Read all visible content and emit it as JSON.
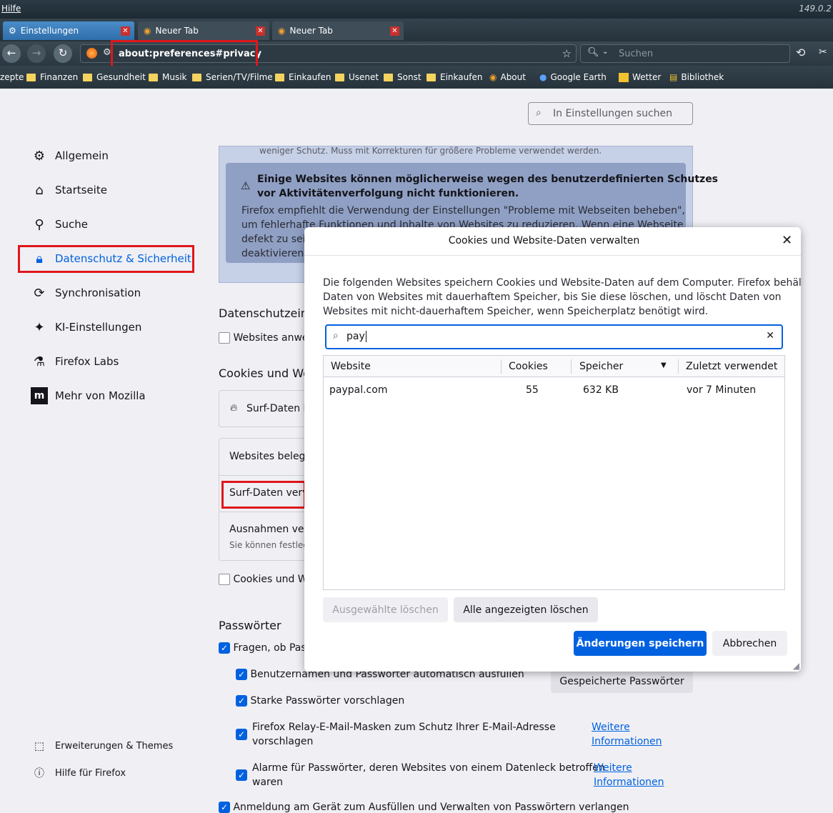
{
  "menubar": {
    "menu_help": "Hilfe",
    "version": "149.0.2"
  },
  "tabs": [
    {
      "label": "Einstellungen",
      "active": true
    },
    {
      "label": "Neuer Tab",
      "active": false
    },
    {
      "label": "Neuer Tab",
      "active": false
    }
  ],
  "urlbar": {
    "url": "about:preferences#privacy"
  },
  "searchbar": {
    "placeholder": "Suchen"
  },
  "bookmarks": [
    {
      "label": "zepte",
      "kind": "cut"
    },
    {
      "label": "Finanzen",
      "kind": "folder"
    },
    {
      "label": "Gesundheit",
      "kind": "folder"
    },
    {
      "label": "Musik",
      "kind": "folder"
    },
    {
      "label": "Serien/TV/Filme",
      "kind": "folder"
    },
    {
      "label": "Einkaufen",
      "kind": "folder"
    },
    {
      "label": "Usenet",
      "kind": "folder"
    },
    {
      "label": "Sonst",
      "kind": "folder"
    },
    {
      "label": "Einkaufen",
      "kind": "folder"
    },
    {
      "label": "About",
      "kind": "link"
    },
    {
      "label": "Google Earth",
      "kind": "link"
    },
    {
      "label": "Wetter",
      "kind": "link"
    },
    {
      "label": "Bibliothek",
      "kind": "link"
    }
  ],
  "prefs_search": {
    "placeholder": "In Einstellungen suchen"
  },
  "sidebar": {
    "items": [
      {
        "label": "Allgemein"
      },
      {
        "label": "Startseite"
      },
      {
        "label": "Suche"
      },
      {
        "label": "Datenschutz & Sicherheit"
      },
      {
        "label": "Synchronisation"
      },
      {
        "label": "KI-Einstellungen"
      },
      {
        "label": "Firefox Labs"
      },
      {
        "label": "Mehr von Mozilla"
      }
    ],
    "footer": [
      {
        "label": "Erweiterungen & Themes"
      },
      {
        "label": "Hilfe für Firefox"
      }
    ]
  },
  "main": {
    "top_note": "weniger Schutz. Muss mit Korrekturen für größere Probleme verwendet werden.",
    "warning_title_1": "Einige Websites können möglicherweise wegen des benutzerdefinierten Schutzes",
    "warning_title_2": "vor Aktivitätenverfolgung nicht funktionieren.",
    "warning_body_1": "Firefox empfiehlt die Verwendung der Einstellungen \"Probleme mit Webseiten beheben\",",
    "warning_body_2": "um fehlerhafte Funktionen und Inhalte von Websites zu reduzieren. Wenn eine Webseite",
    "warning_body_3": "defekt zu sein",
    "warning_body_4": "deaktivieren,",
    "heading_privacy_prefs": "Datenschutzein",
    "websites_checkbox": "Websites anwe",
    "heading_cookies": "Cookies und We",
    "surf_data_button": "Surf-Daten l",
    "websites_occupy": "Websites belege",
    "surf_data_manage": "Surf-Daten verv",
    "exceptions": "Ausnahmen verv",
    "exceptions_sub": "Sie können festleg",
    "cookies_checkbox": "Cookies und W",
    "heading_passwords": "Passwörter",
    "ask_save": "Fragen, ob Pas",
    "autofill": "Benutzernamen und Passwörter automatisch ausfüllen",
    "saved_passwords_button": "Gespeicherte Passwörter",
    "strong_pw": "Starke Passwörter vorschlagen",
    "relay_1": "Firefox Relay-E-Mail-Masken zum Schutz Ihrer E-Mail-Adresse",
    "relay_2": "vorschlagen",
    "more_info_1a": "Weitere",
    "more_info_1b": "Informationen",
    "breach_1": "Alarme für Passwörter, deren Websites von einem Datenleck betroffen",
    "breach_2": "waren",
    "more_info_2a": "Weitere",
    "more_info_2b": "Informationen",
    "bottom_cut": "Anmeldung am Gerät zum Ausfüllen und Verwalten von Passwörtern verlangen"
  },
  "dialog": {
    "title": "Cookies und Website-Daten verwalten",
    "desc_1": "Die folgenden Websites speichern Cookies und Website-Daten auf dem Computer. Firefox behält",
    "desc_2": "Daten von Websites mit dauerhaftem Speicher, bis Sie diese löschen, und löscht Daten von",
    "desc_3": "Websites mit nicht-dauerhaftem Speicher, wenn Speicherplatz benötigt wird.",
    "search_value": "pay",
    "columns": [
      "Website",
      "Cookies",
      "Speicher",
      "Zuletzt verwendet"
    ],
    "rows": [
      {
        "website": "paypal.com",
        "cookies": "55",
        "storage": "632 KB",
        "last_used": "vor 7 Minuten"
      }
    ],
    "btn_delete_selected": "Ausgewählte löschen",
    "btn_delete_shown": "Alle angezeigten löschen",
    "btn_save": "Änderungen speichern",
    "btn_cancel": "Abbrechen"
  },
  "colors": {
    "accent": "#0061e0",
    "highlight": "#e0161b",
    "warning_bg": "#8fa0c4"
  }
}
